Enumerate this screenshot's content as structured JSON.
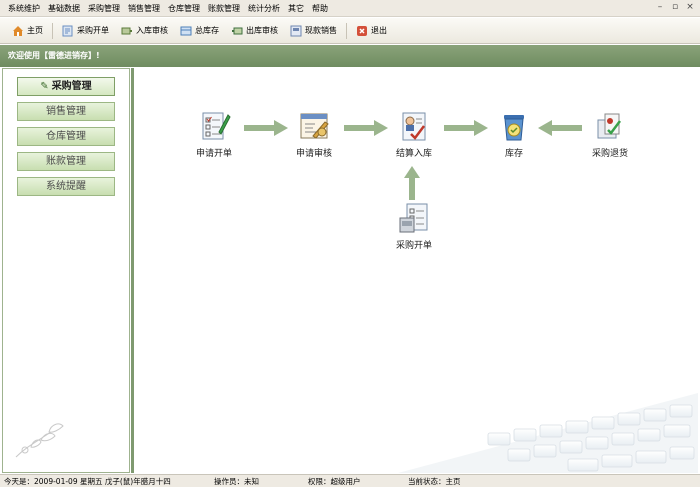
{
  "menu": [
    "系统维护",
    "基础数据",
    "采购管理",
    "销售管理",
    "仓库管理",
    "账款管理",
    "统计分析",
    "其它",
    "帮助"
  ],
  "toolbar": [
    {
      "label": "主页",
      "icon": "home-icon",
      "color": "#e08a2a"
    },
    {
      "label": "采购开单",
      "icon": "purchase-order-icon",
      "color": "#6a8fc2"
    },
    {
      "label": "入库审核",
      "icon": "inbound-audit-icon",
      "color": "#5a7a3a"
    },
    {
      "label": "总库存",
      "icon": "inventory-icon",
      "color": "#4d7fb8"
    },
    {
      "label": "出库审核",
      "icon": "outbound-audit-icon",
      "color": "#3f6f3f"
    },
    {
      "label": "现款销售",
      "icon": "cash-sales-icon",
      "color": "#6f86b0"
    },
    {
      "label": "退出",
      "icon": "exit-icon",
      "color": "#d4503a"
    }
  ],
  "welcome": "欢迎使用【雷德进销存】!",
  "sidebar": {
    "items": [
      "采购管理",
      "销售管理",
      "仓库管理",
      "账款管理",
      "系统提醒"
    ],
    "active_index": 0
  },
  "flow": {
    "nodes": [
      {
        "label": "申请开单",
        "icon": "apply-order-icon"
      },
      {
        "label": "申请审核",
        "icon": "apply-audit-icon"
      },
      {
        "label": "结算入库",
        "icon": "settle-inbound-icon"
      },
      {
        "label": "库存",
        "icon": "stock-icon"
      },
      {
        "label": "采购退货",
        "icon": "purchase-return-icon"
      },
      {
        "label": "采购开单",
        "icon": "purchase-open-icon"
      }
    ]
  },
  "status": {
    "date": "今天是：2009-01-09 星期五 戊子(鼠)年腊月十四",
    "operator": "操作员：未知",
    "permission": "权限：超级用户",
    "state": "当前状态：主页"
  },
  "colors": {
    "accent_green": "#7f9a70",
    "arrow_green": "#9bb58d",
    "menu_bg": "#eeeae2"
  }
}
